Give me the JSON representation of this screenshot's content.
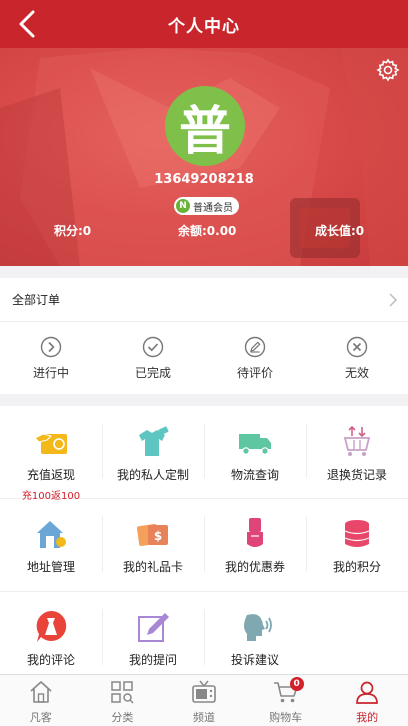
{
  "header": {
    "title": "个人中心"
  },
  "profile": {
    "avatar_char": "普",
    "phone": "13649208218",
    "member_badge_letter": "N",
    "member_level": "普通会员",
    "points": "积分:0",
    "balance": "余额:0.00",
    "growth": "成长值:0"
  },
  "orders": {
    "all_label": "全部订单",
    "statuses": [
      {
        "label": "进行中",
        "icon": "chevron-circle-icon"
      },
      {
        "label": "已完成",
        "icon": "check-circle-icon"
      },
      {
        "label": "待评价",
        "icon": "pencil-circle-icon"
      },
      {
        "label": "无效",
        "icon": "x-circle-icon"
      }
    ]
  },
  "services": [
    {
      "label": "充值返现",
      "sub": "充100返100",
      "icon": "recharge-card-icon"
    },
    {
      "label": "我的私人定制",
      "icon": "tshirt-icon"
    },
    {
      "label": "物流查询",
      "icon": "truck-icon"
    },
    {
      "label": "退换货记录",
      "icon": "cart-return-icon"
    },
    {
      "label": "地址管理",
      "icon": "house-icon"
    },
    {
      "label": "我的礼品卡",
      "icon": "gift-card-icon"
    },
    {
      "label": "我的优惠券",
      "icon": "coupon-hand-icon"
    },
    {
      "label": "我的积分",
      "icon": "coin-stack-icon"
    },
    {
      "label": "我的评论",
      "icon": "comment-dress-icon"
    },
    {
      "label": "我的提问",
      "icon": "question-pen-icon"
    },
    {
      "label": "投诉建议",
      "icon": "complaint-head-icon"
    }
  ],
  "tabs": [
    {
      "label": "凡客",
      "icon": "home-icon"
    },
    {
      "label": "分类",
      "icon": "category-icon"
    },
    {
      "label": "频道",
      "icon": "tv-icon"
    },
    {
      "label": "购物车",
      "icon": "cart-icon",
      "badge": "0"
    },
    {
      "label": "我的",
      "icon": "user-icon",
      "active": true
    }
  ],
  "colors": {
    "brand_red": "#c9252c",
    "avatar_green": "#7ec04a",
    "badge_green": "#6ab33a"
  }
}
